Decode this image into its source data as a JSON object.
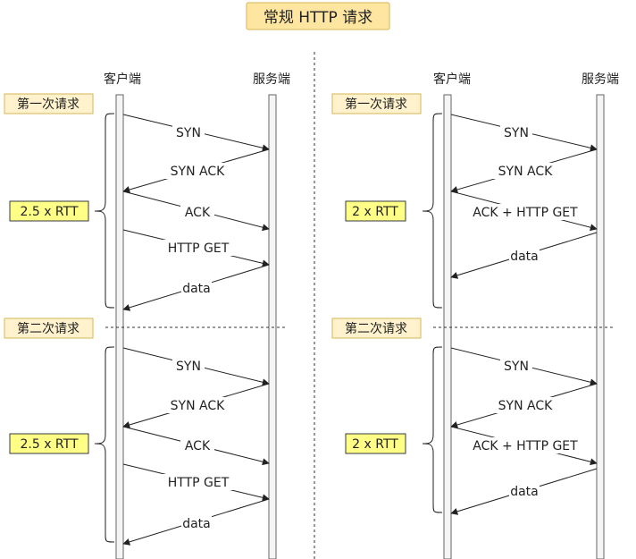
{
  "title": "常规 HTTP 请求",
  "colors": {
    "title_fill": "#ffe6a0",
    "title_border": "#d6b656",
    "req_fill": "#fff2cc",
    "req_border": "#d6b656",
    "rtt_fill": "#ffff88",
    "rtt_border": "#36393d",
    "lifeline_fill": "#f5f5f5",
    "lifeline_border": "#666666",
    "line": "#222222"
  },
  "panels": [
    {
      "client_label": "客户端",
      "server_label": "服务端",
      "requests": [
        {
          "label": "第一次请求",
          "rtt": "2.5 x RTT",
          "messages": [
            {
              "text": "SYN",
              "dir": "to_server"
            },
            {
              "text": "SYN ACK",
              "dir": "to_client"
            },
            {
              "text": "ACK",
              "dir": "to_server"
            },
            {
              "text": "HTTP GET",
              "dir": "to_server"
            },
            {
              "text": "data",
              "dir": "to_client"
            }
          ]
        },
        {
          "label": "第二次请求",
          "rtt": "2.5 x RTT",
          "messages": [
            {
              "text": "SYN",
              "dir": "to_server"
            },
            {
              "text": "SYN ACK",
              "dir": "to_client"
            },
            {
              "text": "ACK",
              "dir": "to_server"
            },
            {
              "text": "HTTP GET",
              "dir": "to_server"
            },
            {
              "text": "data",
              "dir": "to_client"
            }
          ]
        }
      ]
    },
    {
      "client_label": "客户端",
      "server_label": "服务端",
      "requests": [
        {
          "label": "第一次请求",
          "rtt": "2 x RTT",
          "messages": [
            {
              "text": "SYN",
              "dir": "to_server"
            },
            {
              "text": "SYN ACK",
              "dir": "to_client"
            },
            {
              "text": "ACK + HTTP GET",
              "dir": "to_server"
            },
            {
              "text": "data",
              "dir": "to_client"
            }
          ]
        },
        {
          "label": "第二次请求",
          "rtt": "2 x RTT",
          "messages": [
            {
              "text": "SYN",
              "dir": "to_server"
            },
            {
              "text": "SYN ACK",
              "dir": "to_client"
            },
            {
              "text": "ACK + HTTP GET",
              "dir": "to_server"
            },
            {
              "text": "data",
              "dir": "to_client"
            }
          ]
        }
      ]
    }
  ]
}
